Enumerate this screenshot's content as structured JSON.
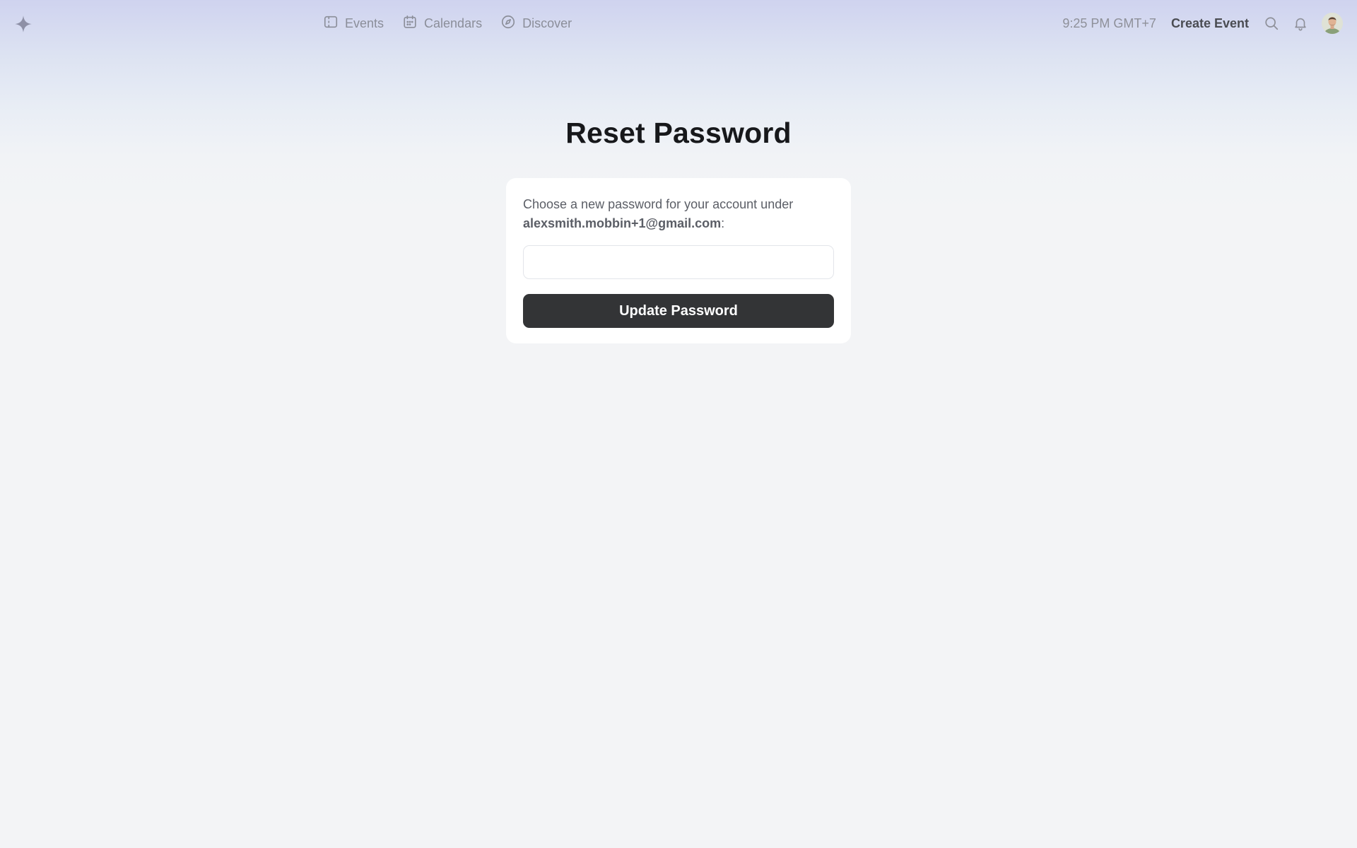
{
  "nav": {
    "items": [
      {
        "label": "Events",
        "icon": "ticket-icon"
      },
      {
        "label": "Calendars",
        "icon": "calendar-icon"
      },
      {
        "label": "Discover",
        "icon": "compass-icon"
      }
    ]
  },
  "header": {
    "time": "9:25 PM GMT+7",
    "create_label": "Create Event"
  },
  "main": {
    "title": "Reset Password",
    "description": "Choose a new password for your account under",
    "email": "alexsmith.mobbin+1@gmail.com",
    "suffix": ":",
    "password_value": "",
    "submit_label": "Update Password"
  },
  "colors": {
    "button": "#333436",
    "gradient_top": "#cfd3ef",
    "background": "#f3f4f6"
  }
}
